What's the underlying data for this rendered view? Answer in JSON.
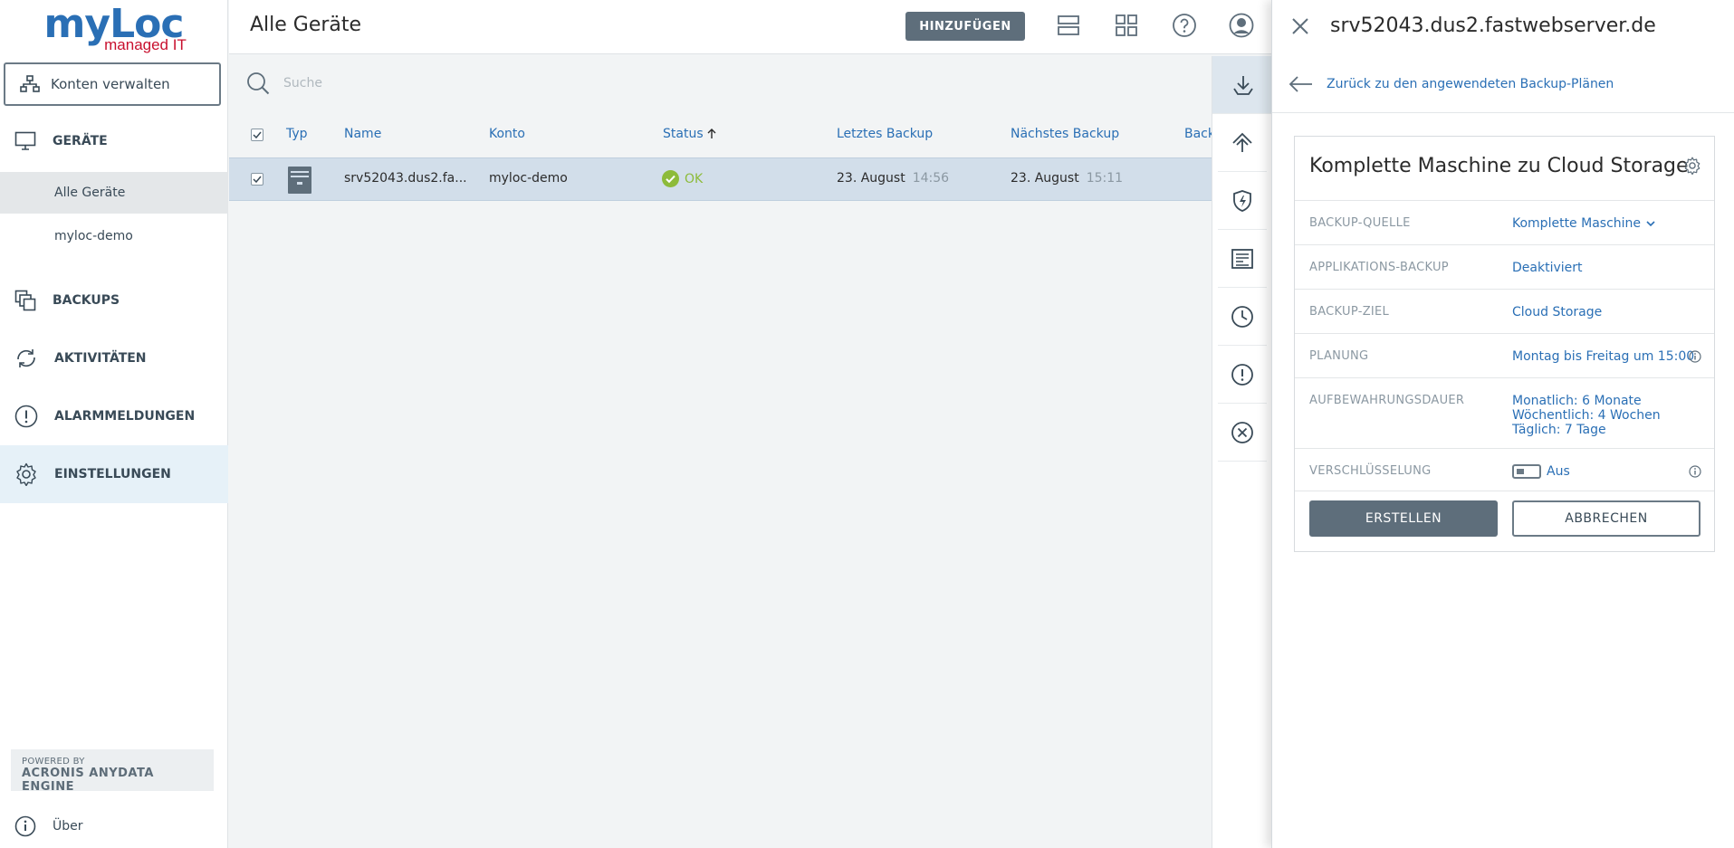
{
  "brand": {
    "logo_main": "myLoc",
    "logo_sub": "managed IT",
    "primary": "#2a6fb5",
    "accent": "#c8102e"
  },
  "sidebar": {
    "accounts_button": "Konten verwalten",
    "sections": [
      {
        "label": "GERÄTE",
        "icon": "monitor-icon"
      },
      {
        "label": "BACKUPS",
        "icon": "backups-icon"
      },
      {
        "label": "AKTIVITÄTEN",
        "icon": "activities-icon"
      },
      {
        "label": "ALARMMELDUNGEN",
        "icon": "alert-icon"
      },
      {
        "label": "EINSTELLUNGEN",
        "icon": "gear-icon"
      }
    ],
    "sub_items": [
      {
        "label": "Alle Geräte"
      },
      {
        "label": "myloc-demo"
      }
    ],
    "powered_by": "POWERED BY",
    "engine": "ACRONIS ANYDATA ENGINE",
    "about": "Über"
  },
  "header": {
    "title": "Alle Geräte",
    "add_button": "HINZUFÜGEN"
  },
  "search": {
    "placeholder": "Suche"
  },
  "table": {
    "columns": [
      "Typ",
      "Name",
      "Konto",
      "Status",
      "Letztes Backup",
      "Nächstes Backup",
      "Back"
    ],
    "sort_column": "Status",
    "rows": [
      {
        "name": "srv52043.dus2.fa...",
        "account": "myloc-demo",
        "status": "OK",
        "last_backup_date": "23. August",
        "last_backup_time": "14:56",
        "next_backup_date": "23. August",
        "next_backup_time": "15:11"
      }
    ]
  },
  "panel": {
    "title": "srv52043.dus2.fastwebserver.de",
    "back_link": "Zurück zu den angewendeten Backup-Plänen",
    "plan": {
      "name": "Komplette Maschine zu Cloud Storage",
      "properties": [
        {
          "label": "BACKUP-QUELLE",
          "value": "Komplette Maschine"
        },
        {
          "label": "APPLIKATIONS-BACKUP",
          "value": "Deaktiviert"
        },
        {
          "label": "BACKUP-ZIEL",
          "value": "Cloud Storage"
        },
        {
          "label": "PLANUNG",
          "value": "Montag bis Freitag um 15:00"
        },
        {
          "label": "AUFBEWAHRUNGSDAUER",
          "lines": [
            "Monatlich: 6 Monate",
            "Wöchentlich: 4 Wochen",
            "Täglich: 7 Tage"
          ]
        },
        {
          "label": "VERSCHLÜSSELUNG",
          "value": "Aus"
        }
      ],
      "create_button": "ERSTELLEN",
      "cancel_button": "ABBRECHEN"
    }
  }
}
